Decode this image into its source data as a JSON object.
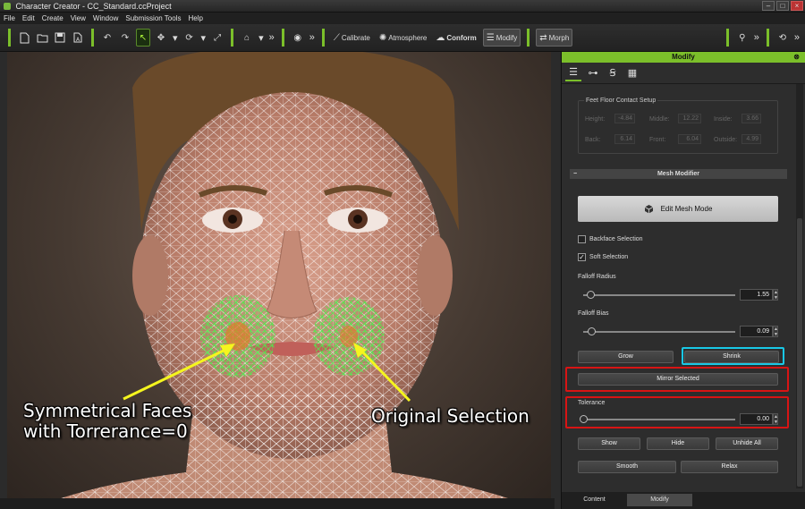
{
  "window": {
    "title": "Character Creator - CC_Standard.ccProject"
  },
  "menu": [
    "File",
    "Edit",
    "Create",
    "View",
    "Window",
    "Submission Tools",
    "Help"
  ],
  "toolbar": {
    "calibrate": "Calibrate",
    "atmosphere": "Atmosphere",
    "conform": "Conform",
    "modify": "Modify",
    "morph": "Morph",
    "more": "»"
  },
  "annotations": {
    "symmetrical_line1": "Symmetrical Faces",
    "symmetrical_line2": "with Torrerance=0",
    "original": "Original Selection"
  },
  "panel": {
    "title": "Modify",
    "close": "⊗",
    "feet": {
      "title": "Feet Floor Contact Setup",
      "height_label": "Height:",
      "height": "-4.84",
      "middle_label": "Middle:",
      "middle": "12.22",
      "inside_label": "Inside:",
      "inside": "3.66",
      "back_label": "Back:",
      "back": "6.14",
      "front_label": "Front:",
      "front": "6.04",
      "outside_label": "Outside:",
      "outside": "4.99"
    },
    "mesh_modifier": {
      "header": "Mesh Modifier",
      "collapse": "−",
      "edit_mesh_mode": "Edit Mesh Mode",
      "backface_selection": "Backface Selection",
      "backface_checked": false,
      "soft_selection": "Soft Selection",
      "soft_checked": true,
      "falloff_radius_label": "Falloff Radius",
      "falloff_radius": "1.55",
      "falloff_bias_label": "Falloff Bias",
      "falloff_bias": "0.09",
      "grow": "Grow",
      "shrink": "Shrink",
      "mirror_selected": "Mirror Selected",
      "tolerance_label": "Tolerance",
      "tolerance": "0.00",
      "show": "Show",
      "hide": "Hide",
      "unhide_all": "Unhide All",
      "smooth": "Smooth",
      "relax": "Relax",
      "check_mark": "✓",
      "spin_up": "▲",
      "spin_down": "▼"
    },
    "bottom_tabs": [
      "Content",
      "Modify"
    ]
  },
  "colors": {
    "accent": "#7bbf2a",
    "highlight_red": "#d81414",
    "highlight_cyan": "#19c8e6",
    "arrow": "#f5f51e"
  }
}
